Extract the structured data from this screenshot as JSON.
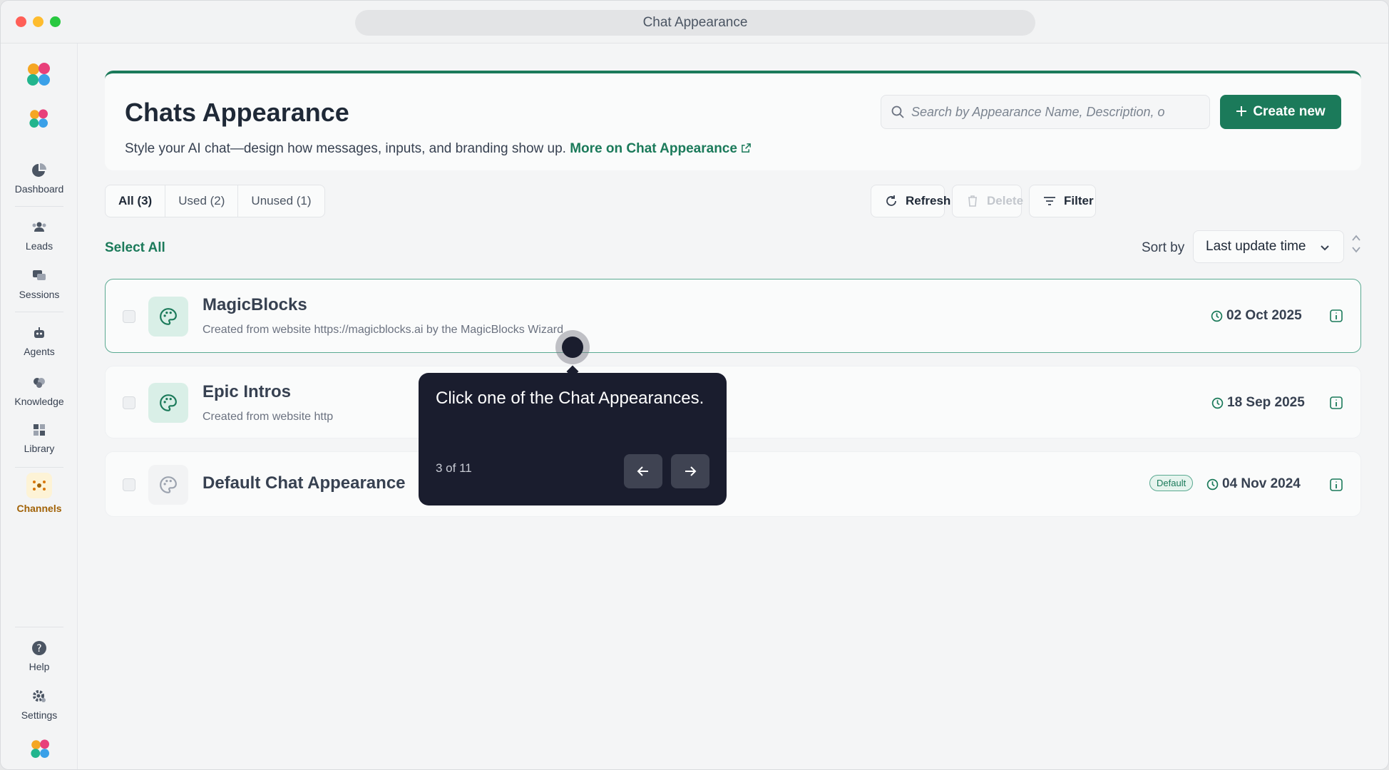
{
  "window": {
    "title": "Chat Appearance"
  },
  "sidebar": {
    "items": [
      {
        "label": "Dashboard",
        "icon": "pie-chart-icon"
      },
      {
        "label": "Leads",
        "icon": "users-icon"
      },
      {
        "label": "Sessions",
        "icon": "chat-bubbles-icon"
      },
      {
        "label": "Agents",
        "icon": "robot-icon"
      },
      {
        "label": "Knowledge",
        "icon": "brain-icon"
      },
      {
        "label": "Library",
        "icon": "grid-icon"
      },
      {
        "label": "Channels",
        "icon": "channels-icon",
        "active": true
      }
    ],
    "bottom": [
      {
        "label": "Help",
        "icon": "help-icon"
      },
      {
        "label": "Settings",
        "icon": "gear-icon"
      }
    ]
  },
  "header": {
    "title": "Chats Appearance",
    "subtitle": "Style your AI chat—design how messages, inputs, and branding show up.",
    "link": "More on Chat Appearance",
    "search_placeholder": "Search by Appearance Name, Description, o",
    "create_label": "Create new"
  },
  "tabs": [
    {
      "label": "All (3)",
      "active": true
    },
    {
      "label": "Used (2)"
    },
    {
      "label": "Unused (1)"
    }
  ],
  "toolbar": {
    "refresh": "Refresh",
    "delete": "Delete",
    "filter": "Filter"
  },
  "list": {
    "select_all": "Select All",
    "sort_label": "Sort by",
    "sort_value": "Last update time",
    "rows": [
      {
        "title": "MagicBlocks",
        "description": "Created from website https://magicblocks.ai by the MagicBlocks Wizard",
        "date": "02 Oct 2025"
      },
      {
        "title": "Epic Intros",
        "description": "Created from website http",
        "date": "18 Sep 2025"
      },
      {
        "title": "Default Chat Appearance",
        "description": "",
        "badge": "Default",
        "date": "04 Nov 2024"
      }
    ]
  },
  "tooltip": {
    "text": "Click one of the Chat Appearances.",
    "step": "3 of 11"
  },
  "colors": {
    "accent": "#1b7a5a",
    "tooltip_bg": "#1a1d2e"
  }
}
